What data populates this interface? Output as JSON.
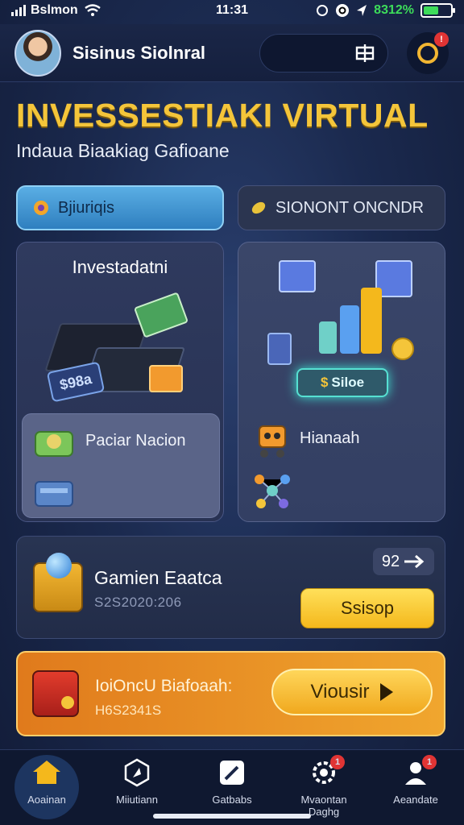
{
  "status_bar": {
    "carrier": "Bslmon",
    "time": "11:31",
    "battery_pct": "8312%",
    "battery_level": 0.55
  },
  "header": {
    "username": "Sisinus Siolnral",
    "search_icon": "grid-icon",
    "notification_icon": "ring-icon",
    "notification_badge": "!"
  },
  "hero": {
    "title": "INVESSESTIAKI VIRTUAL",
    "subtitle": "Indaua Biaakiag Gafioane"
  },
  "tabs": [
    {
      "label": "Bjiuriqis",
      "icon": "gear-icon",
      "active": true
    },
    {
      "label": "SIONONT ONCNDR",
      "icon": "leaf-icon",
      "active": false
    }
  ],
  "cards": {
    "left": {
      "heading": "Investadatni",
      "tag_label": "$98a",
      "row_label": "Paciar Nacion"
    },
    "right": {
      "value_label": "Siloe",
      "value_prefix": "$",
      "row_label": "Hianaah"
    }
  },
  "game": {
    "title": "Gamien Eaatca",
    "code": "S2S2020:206",
    "count": "92",
    "button_label": "Ssisop"
  },
  "promo": {
    "title": "IoiOncU Biafoaah:",
    "subtitle": "H6S2341S",
    "button_label": "Viousir"
  },
  "tabbar": [
    {
      "label": "Aoainan",
      "icon": "home-icon",
      "active": true
    },
    {
      "label": "Miiutiann",
      "icon": "compass-icon",
      "active": false
    },
    {
      "label": "Gatbabs",
      "icon": "pencil-icon",
      "active": false
    },
    {
      "label": "Mvaontan Daghg",
      "icon": "gear-icon",
      "active": false,
      "badge": "1"
    },
    {
      "label": "Aeandate",
      "icon": "user-icon",
      "active": false,
      "badge": "1"
    }
  ],
  "colors": {
    "accent_gold": "#f4c53a",
    "active_tab": "#5aaee4",
    "promo_orange": "#e07a1c",
    "background": "#1b2a4f"
  }
}
